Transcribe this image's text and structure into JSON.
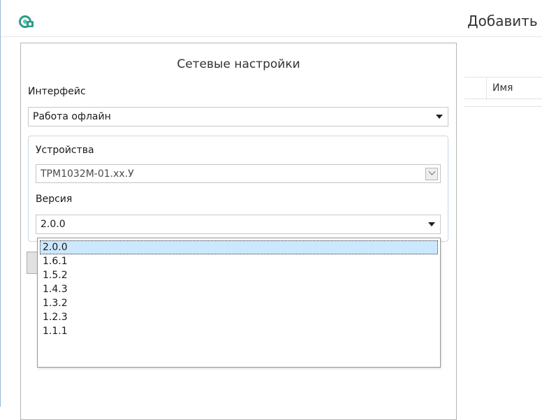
{
  "window": {
    "title": "Добавить"
  },
  "panel": {
    "title": "Сетевые настройки",
    "interface_label": "Интерфейс",
    "interface_value": "Работа офлайн",
    "devices_label": "Устройства",
    "device_value": "ТРМ1032М-01.xx.У",
    "version_label": "Версия",
    "version_value": "2.0.0",
    "version_options": [
      "2.0.0",
      "1.6.1",
      "1.5.2",
      "1.4.3",
      "1.3.2",
      "1.2.3",
      "1.1.1"
    ]
  },
  "table": {
    "column_name": "Имя"
  },
  "icons": {
    "app": "app-logo-icon",
    "dropdown": "triangle-down-icon",
    "disabled_dropdown": "chevron-down-icon"
  },
  "colors": {
    "accent_icon": "#2e9a8a",
    "selection": "#cce8ff"
  }
}
